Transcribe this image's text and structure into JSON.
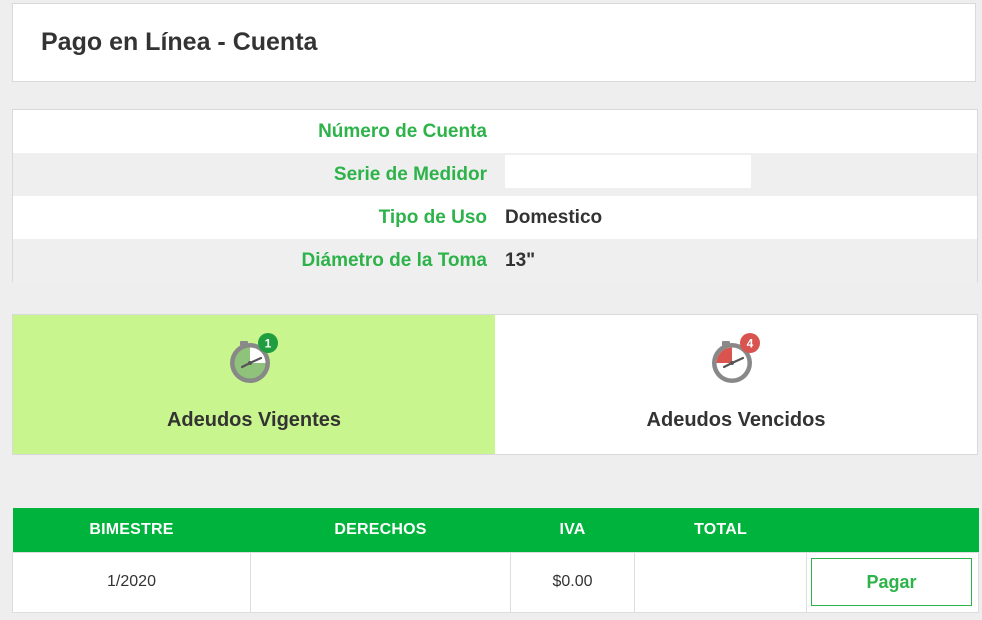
{
  "page": {
    "title": "Pago en Línea - Cuenta"
  },
  "account_info": [
    {
      "label": "Número de Cuenta",
      "value": ""
    },
    {
      "label": "Serie de Medidor",
      "value": ""
    },
    {
      "label": "Tipo de Uso",
      "value": "Domestico"
    },
    {
      "label": "Diámetro de la Toma",
      "value": "13\""
    }
  ],
  "debt_tabs": [
    {
      "label": "Adeudos Vigentes",
      "badge": "1",
      "badge_color": "#1e9e3e",
      "active": true,
      "icon": "clock-icon"
    },
    {
      "label": "Adeudos Vencidos",
      "badge": "4",
      "badge_color": "#d9534f",
      "active": false,
      "icon": "clock-overdue-icon"
    }
  ],
  "colors": {
    "accent_green": "#2db34a",
    "table_header_green": "#00b33c",
    "active_tab_bg": "#c8f58d"
  },
  "table": {
    "headers": [
      "BIMESTRE",
      "DERECHOS",
      "IVA",
      "TOTAL",
      ""
    ],
    "rows": [
      {
        "bimestre": "1/2020",
        "derechos": "",
        "iva": "$0.00",
        "total": "",
        "action_label": "Pagar"
      }
    ]
  }
}
